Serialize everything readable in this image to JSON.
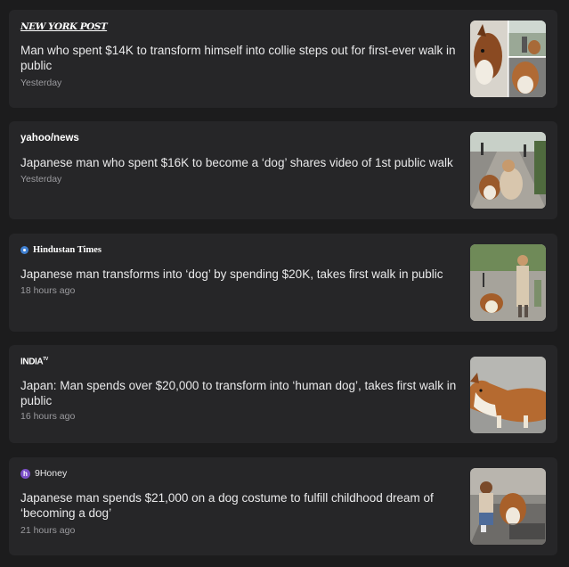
{
  "articles": [
    {
      "source": "NEW YORK POST",
      "title": "Man who spent $14K to transform himself into collie steps out for first-ever walk in public",
      "time": "Yesterday",
      "thumb_icon": "collie-costume-photo"
    },
    {
      "source": "yahoo/news",
      "title": "Japanese man who spent $16K to become a ‘dog’ shares video of 1st public walk",
      "time": "Yesterday",
      "thumb_icon": "woman-with-dog-photo"
    },
    {
      "source": "Hindustan Times",
      "title": "Japanese man transforms into ‘dog’ by spending $20K, takes first walk in public",
      "time": "18 hours ago",
      "thumb_icon": "street-walk-photo"
    },
    {
      "source": "INDIA",
      "source_suffix": "TV",
      "title": "Japan: Man spends over $20,000 to transform into ‘human dog’, takes first walk in public",
      "time": "16 hours ago",
      "thumb_icon": "collie-closeup-photo"
    },
    {
      "source": "9Honey",
      "source_badge": "h",
      "title": "Japanese man spends $21,000 on a dog costume to fulfill childhood dream of ‘becoming a dog’",
      "time": "21 hours ago",
      "thumb_icon": "woman-petting-dog-photo"
    }
  ],
  "colors": {
    "page_bg": "#1c1c1d",
    "card_bg": "#262628",
    "title_text": "#e9e9ea",
    "meta_text": "#9b9b9f",
    "hindustan_accent": "#3f7fd0",
    "ninehoney_accent": "#7b4fc7"
  }
}
